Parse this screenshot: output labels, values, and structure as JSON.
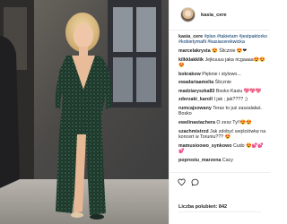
{
  "post": {
    "username": "kasia_cere",
    "likes_label": "Liczba polubień:",
    "likes_count": "842",
    "comments": [
      {
        "user": "kasia_cere",
        "text": "",
        "tags": "#plan #takietam #jestpaktorko #kobietymafii #kasiacerekwicka"
      },
      {
        "user": "marcelakrysta",
        "text": "😍 Ślicznie 😍❤"
      },
      {
        "user": "kilkklakklik",
        "text": "Jejkuuuu jaka ricgaaaa😍😍😍"
      },
      {
        "user": "bokrakow",
        "text": "Pięknie i stylowo..."
      },
      {
        "user": "ewadariaamelia",
        "text": "Ślicznie"
      },
      {
        "user": "madziaryszka83",
        "text": "Bosko Kasiu 💖💖💖"
      },
      {
        "user": "zderzaki_karoll",
        "text": "I jak ; jak????  ;)"
      },
      {
        "user": "rumcajsowany",
        "text": "Teraz to już zaszalałaś. Bosko"
      },
      {
        "user": "ewelinastachera",
        "text": "O zesz Ty!!😍😍"
      },
      {
        "user": "szachmistrzd",
        "text": "Jak zdobyć wejściówkę na koncert w Toruniu??? 😍"
      },
      {
        "user": "mamusioowo_synkowo",
        "text": "Cudo 😍💕💕💕"
      },
      {
        "user": "poprostu_marzena",
        "text": "Cacy"
      }
    ]
  },
  "icons": [
    "avatar",
    "heart-icon",
    "comment-icon"
  ],
  "colors": {
    "border": "#efefef",
    "text": "#262626",
    "link": "#003569",
    "dress": "#1f3a2c"
  }
}
